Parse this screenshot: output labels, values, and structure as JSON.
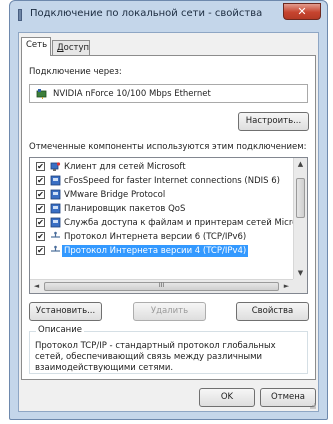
{
  "window": {
    "title": "Подключение по локальной сети - свойства",
    "close_glyph": "✕"
  },
  "tabs": [
    {
      "label": "Сеть"
    },
    {
      "label_rest": "оступ",
      "label_mnemonic": "Д"
    }
  ],
  "connect_via": {
    "label": "Подключение через:",
    "adapter": "NVIDIA nForce 10/100 Mbps Ethernet",
    "configure_button": "Настроить..."
  },
  "components": {
    "label": "Отмеченные компоненты используются этим подключением:",
    "items": [
      {
        "label": "Клиент для сетей Microsoft",
        "checked": true,
        "icon": "network-client-icon"
      },
      {
        "label": "cFosSpeed for faster Internet connections (NDIS 6)",
        "checked": true,
        "icon": "network-service-icon"
      },
      {
        "label": "VMware Bridge Protocol",
        "checked": true,
        "icon": "network-service-icon"
      },
      {
        "label": "Планировщик пакетов QoS",
        "checked": true,
        "icon": "network-service-icon"
      },
      {
        "label": "Служба доступа к файлам и принтерам сетей Micro",
        "checked": true,
        "icon": "network-service-icon"
      },
      {
        "label": "Протокол Интернета версии 6 (TCP/IPv6)",
        "checked": true,
        "icon": "protocol-icon"
      },
      {
        "label": "Протокол Интернета версии 4 (TCP/IPv4)",
        "checked": true,
        "icon": "protocol-icon",
        "selected": true
      }
    ],
    "check_glyph": "✔",
    "scroll_up": "▲",
    "scroll_down": "▼",
    "scroll_left": "◄",
    "scroll_right": "►",
    "hthumb_grip": "III"
  },
  "actions": {
    "install": "Установить...",
    "remove": "Удалить",
    "properties": "Свойства"
  },
  "description": {
    "title": "Описание",
    "text": "Протокол TCP/IP - стандартный протокол глобальных сетей, обеспечивающий связь между различными взаимодействующими сетями."
  },
  "footer": {
    "ok": "OK",
    "cancel": "Отмена"
  },
  "colors": {
    "selection": "#3399ff",
    "titlebar": "#c4d6ea",
    "close": "#c6442f"
  }
}
